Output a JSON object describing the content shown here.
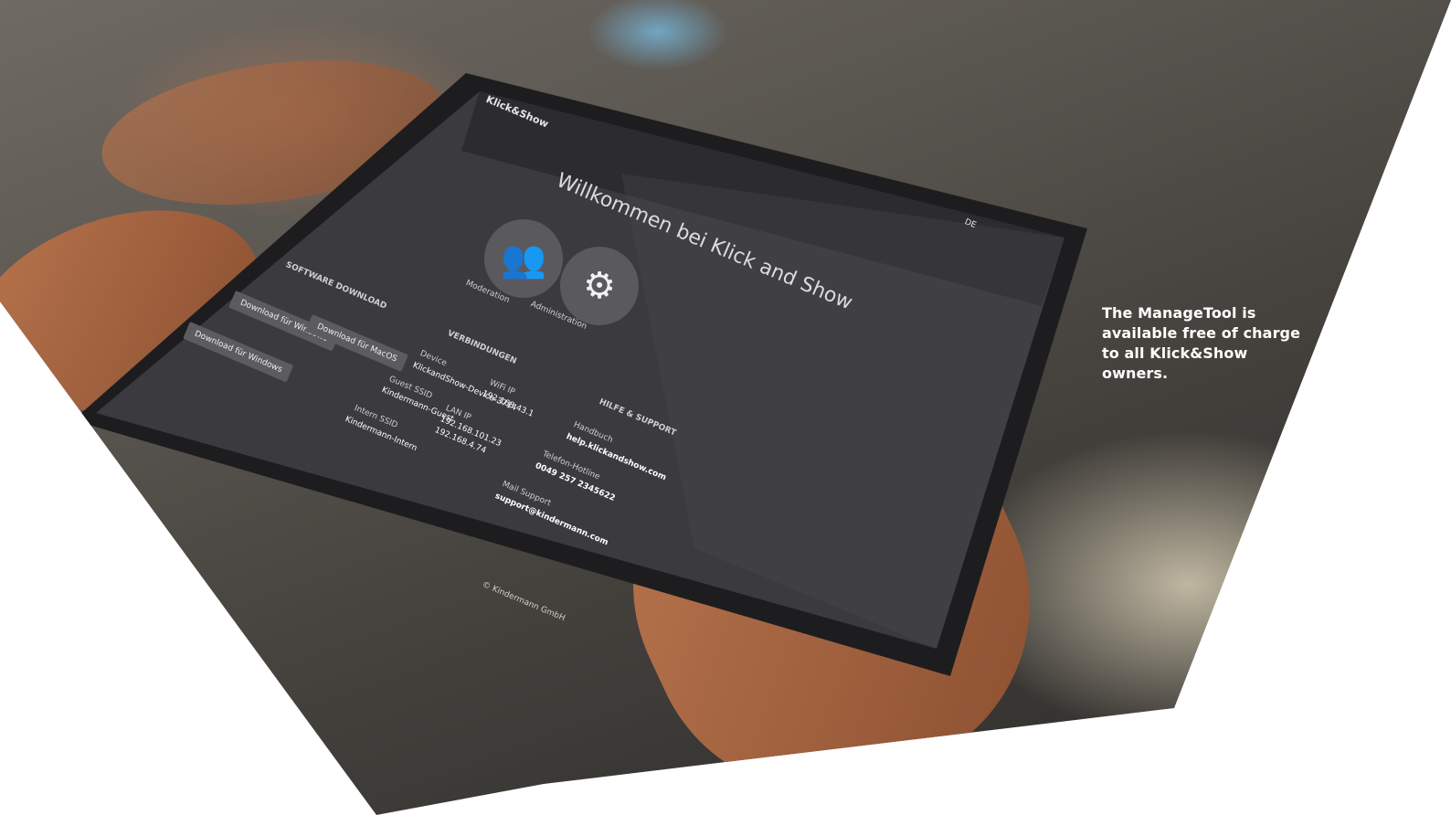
{
  "caption": {
    "line1": "The ManageTool is",
    "line2": "available free of charge",
    "line3": "to all Klick&Show",
    "line4": "owners."
  },
  "tablet_screen": {
    "logo": "Klick&Show",
    "language": "DE",
    "welcome": "Willkommen bei Klick and Show",
    "moderation_label": "Moderation",
    "administration_label": "Administration",
    "software_download": "SOFTWARE DOWNLOAD",
    "download_windows": "Download für Windows",
    "download_macos": "Download für MacOS",
    "connections": "VERBINDUNGEN",
    "device_label": "Device",
    "device_value": "KlickandShow-Device-3714",
    "guest_label": "Guest SSID",
    "guest_value": "Kindermann-Guest",
    "intern_label": "Intern SSID",
    "intern_value": "Kindermann-Intern",
    "wifi_label": "WiFi IP",
    "wifi_value": "192.168.43.1",
    "lan_label": "LAN IP",
    "lan_value_1": "192.168.101.23",
    "lan_value_2": "192.168.4.74",
    "help_support": "HILFE & SUPPORT",
    "manual_label": "Handbuch",
    "manual_value": "help.klickandshow.com",
    "phone_label": "Telefon-Hotline",
    "phone_value": "0049 257 2345622",
    "mail_label": "Mail Support",
    "mail_value": "support@kindermann.com",
    "copyright": "© Kindermann GmbH"
  },
  "colors": {
    "screen": "#3b3b3f",
    "caption_text": "#ffffff",
    "background": "#ffffff"
  }
}
